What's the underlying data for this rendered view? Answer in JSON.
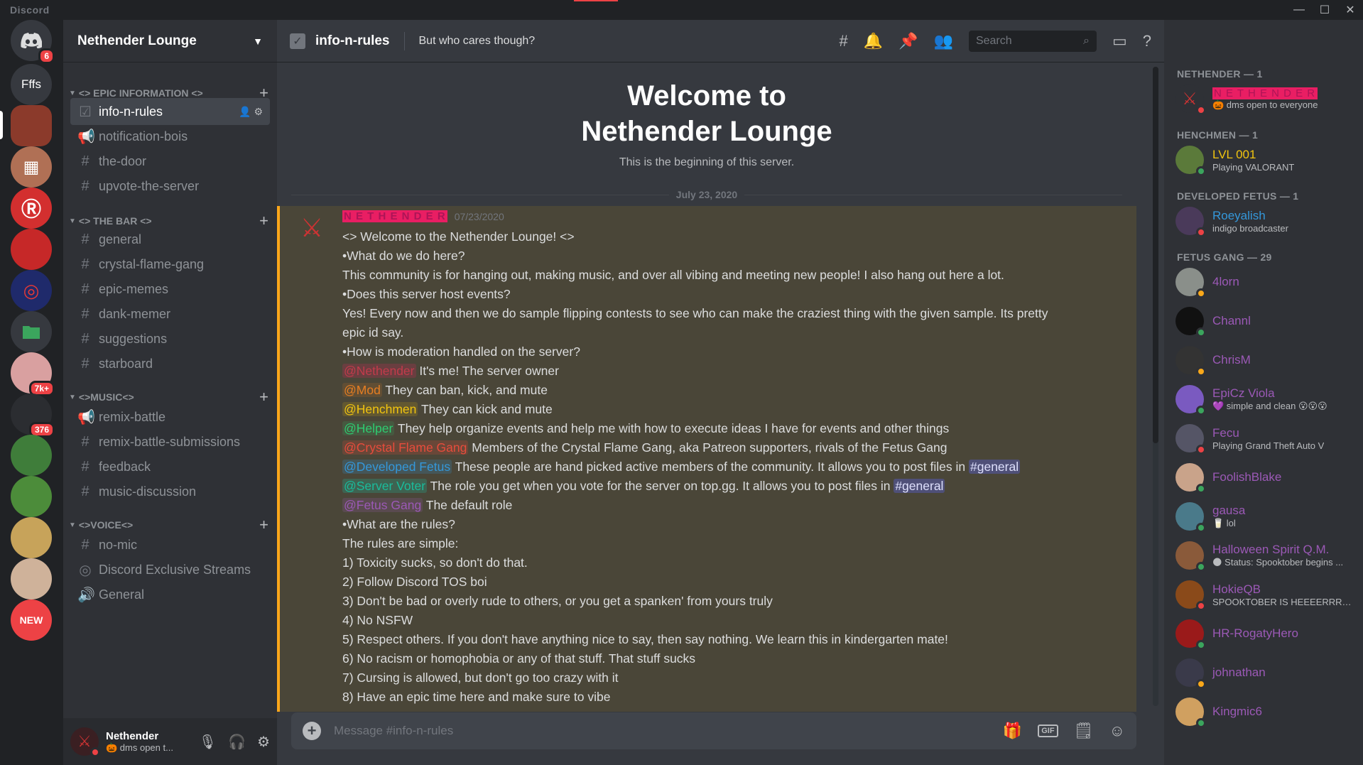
{
  "app": {
    "brand": "Discord",
    "window_controls": [
      "—",
      "☐",
      "✕"
    ]
  },
  "guilds": [
    {
      "label": "",
      "badge": "6",
      "color": "#36393f",
      "icon": "discord-home-icon"
    },
    {
      "label": "Fffs",
      "badge": "",
      "color": "#36393f"
    },
    {
      "label": "",
      "badge": "",
      "color": "#8b3a2b"
    },
    {
      "label": "",
      "badge": "",
      "color": "#b07055"
    },
    {
      "label": "",
      "badge": "",
      "color": "#d32f2f"
    },
    {
      "label": "",
      "badge": "",
      "color": "#c62828"
    },
    {
      "label": "",
      "badge": "",
      "color": "#1f2a6b"
    },
    {
      "label": "",
      "badge": "",
      "color": "#36393f",
      "icon": "folder-icon"
    },
    {
      "label": "",
      "badge": "7k+",
      "color": "#d9a0a0"
    },
    {
      "label": "",
      "badge": "376",
      "color": "#2b2d31"
    },
    {
      "label": "",
      "badge": "",
      "color": "#3f7d3a"
    },
    {
      "label": "",
      "badge": "",
      "color": "#4c8c3a"
    },
    {
      "label": "",
      "badge": "",
      "color": "#c7a35a"
    },
    {
      "label": "",
      "badge": "",
      "color": "#cfb29a"
    },
    {
      "label": "NEW",
      "badge": "",
      "color": "#ed4245"
    }
  ],
  "server": {
    "name": "Nethender Lounge",
    "categories": [
      {
        "label": "<> EPIC INFORMATION <>"
      },
      {
        "label": "<> THE BAR <>"
      },
      {
        "label": "<>MUSIC<>"
      },
      {
        "label": "<>VOICE<>"
      }
    ],
    "channels": [
      {
        "label": "info-n-rules",
        "icon": "☑",
        "active": true
      },
      {
        "label": "notification-bois",
        "icon": "📢"
      },
      {
        "label": "the-door",
        "icon": "#"
      },
      {
        "label": "upvote-the-server",
        "icon": "#"
      },
      {
        "label": "general",
        "icon": "#"
      },
      {
        "label": "crystal-flame-gang",
        "icon": "#"
      },
      {
        "label": "epic-memes",
        "icon": "#"
      },
      {
        "label": "dank-memer",
        "icon": "#"
      },
      {
        "label": "suggestions",
        "icon": "#"
      },
      {
        "label": "starboard",
        "icon": "#"
      },
      {
        "label": "remix-battle",
        "icon": "📢"
      },
      {
        "label": "remix-battle-submissions",
        "icon": "#"
      },
      {
        "label": "feedback",
        "icon": "#"
      },
      {
        "label": "music-discussion",
        "icon": "#"
      },
      {
        "label": "no-mic",
        "icon": "#"
      },
      {
        "label": "Discord Exclusive Streams",
        "icon": "◎"
      },
      {
        "label": "General",
        "icon": "🔊"
      }
    ]
  },
  "user_panel": {
    "name": "Nethender",
    "status": "🎃 dms open t..."
  },
  "topbar": {
    "channel": "info-n-rules",
    "topic": "But who cares though?",
    "search_placeholder": "Search"
  },
  "welcome": {
    "line1": "Welcome to",
    "line2": "Nethender Lounge",
    "sub": "This is the beginning of this server.",
    "date_divider": "July 23, 2020"
  },
  "message": {
    "author": "N E T H E N D E R",
    "timestamp": "07/23/2020",
    "intro": "<> Welcome to the Nethender Lounge! <>",
    "q1": "•What do we do here?",
    "a1": "This community is for hanging out, making music, and over all vibing and meeting new people! I also hang out here a lot.",
    "q2": "•Does this server host events?",
    "a2": "Yes! Every now and then we do sample flipping contests to see who can make the craziest thing with the given sample. Its pretty epic id say.",
    "q3": "•How is moderation handled on the server?",
    "roles": [
      {
        "mention": "@Nethender",
        "text": " It's me! The server owner"
      },
      {
        "mention": "@Mod",
        "text": " They can ban, kick, and mute"
      },
      {
        "mention": "@Henchmen",
        "text": " They can kick and mute"
      },
      {
        "mention": "@Helper",
        "text": " They help organize events and help me with how to execute ideas I have for events and other things"
      },
      {
        "mention": "@Crystal Flame Gang",
        "text": " Members of the Crystal Flame Gang, aka Patreon supporters, rivals of the Fetus Gang"
      },
      {
        "mention": "@Developed Fetus",
        "text": " These people are hand picked active members of the community. It allows you to post files in ",
        "ref": "#general"
      },
      {
        "mention": "@Server Voter",
        "text": " The role you get when you vote for the server on top.gg. It allows you to post files in ",
        "ref": "#general"
      },
      {
        "mention": "@Fetus Gang",
        "text": " The default role"
      }
    ],
    "q4": "•What are the rules?",
    "a4": "The rules are simple:",
    "rules": [
      "1) Toxicity sucks, so don't do that.",
      "2) Follow Discord TOS boi",
      "3) Don't be bad or overly rude to others, or you get a spanken' from yours truly",
      "4) No NSFW",
      "5) Respect others. If you don't have anything nice to say, then say nothing. We learn this in kindergarten mate!",
      "6) No racism or homophobia or any of that stuff. That stuff sucks",
      "7) Cursing is allowed, but don't go too crazy with it",
      "8) Have an epic time here and make sure to vibe"
    ]
  },
  "composer": {
    "placeholder": "Message #info-n-rules",
    "gif_label": "GIF"
  },
  "member_groups": [
    {
      "label": "NETHENDER — 1"
    },
    {
      "label": "HENCHMEN — 1"
    },
    {
      "label": "DEVELOPED FETUS — 1"
    },
    {
      "label": "FETUS GANG — 29"
    }
  ],
  "members": [
    {
      "name": "N E T H E N D E R",
      "activity": "🎃 dms open to everyone",
      "color": "#e91e63",
      "status": "dnd"
    },
    {
      "name": "LVL 001",
      "activity": "Playing VALORANT",
      "color": "#f1c40f",
      "status": "online"
    },
    {
      "name": "Roeyalish",
      "activity": "indigo broadcaster",
      "color": "#3498db",
      "status": "dnd"
    },
    {
      "name": "4lorn",
      "activity": "",
      "color": "#9b59b6",
      "status": "idle"
    },
    {
      "name": "Channl",
      "activity": "",
      "color": "#9b59b6",
      "status": "online"
    },
    {
      "name": "ChrisM",
      "activity": "",
      "color": "#9b59b6",
      "status": "idle"
    },
    {
      "name": "EpiCz Viola",
      "activity": "💜 simple and clean 😮😮😮",
      "color": "#9b59b6",
      "status": "online"
    },
    {
      "name": "Fecu",
      "activity": "Playing Grand Theft Auto V",
      "color": "#9b59b6",
      "status": "dnd"
    },
    {
      "name": "FoolishBlake",
      "activity": "",
      "color": "#9b59b6",
      "status": "online"
    },
    {
      "name": "gausa",
      "activity": "🥛 lol",
      "color": "#9b59b6",
      "status": "online"
    },
    {
      "name": "Halloween Spirit Q.M.",
      "activity": "🌑 Status: Spooktober begins ...",
      "color": "#9b59b6",
      "status": "online"
    },
    {
      "name": "HokieQB",
      "activity": "SPOOKTOBER IS HEEEERRRRR...",
      "color": "#9b59b6",
      "status": "dnd"
    },
    {
      "name": "HR-RogatyHero",
      "activity": "",
      "color": "#9b59b6",
      "status": "online"
    },
    {
      "name": "johnathan",
      "activity": "",
      "color": "#9b59b6",
      "status": "idle"
    },
    {
      "name": "Kingmic6",
      "activity": "",
      "color": "#9b59b6",
      "status": "online"
    }
  ]
}
